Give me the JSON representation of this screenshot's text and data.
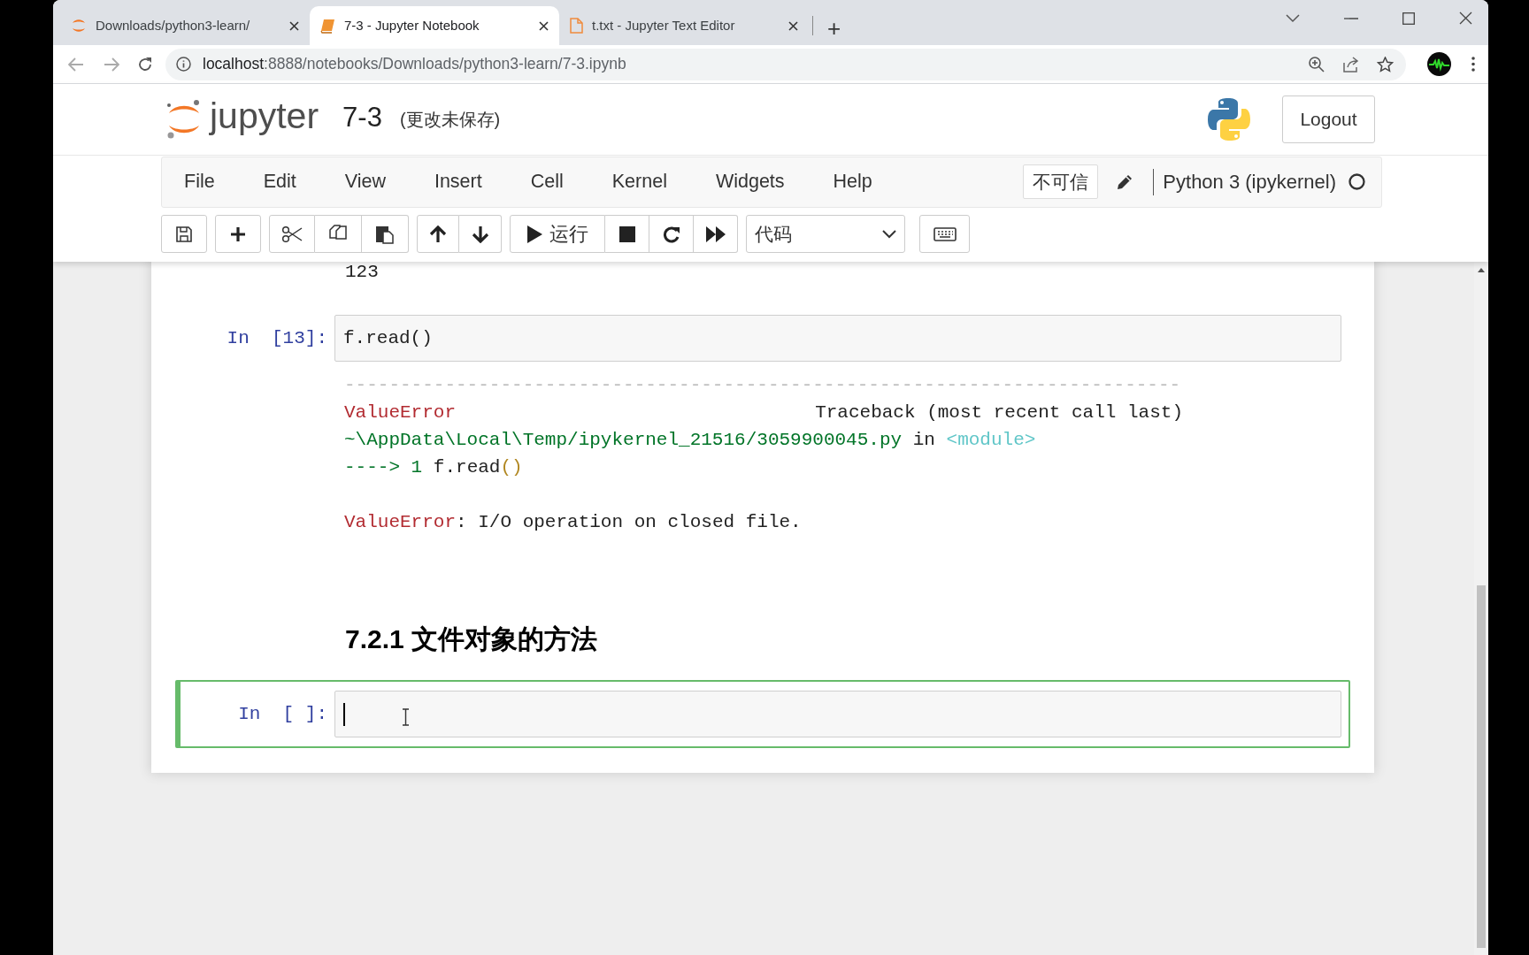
{
  "browser": {
    "tabs": [
      {
        "title": "Downloads/python3-learn/",
        "kind": "jupyter",
        "selected": false
      },
      {
        "title": "7-3 - Jupyter Notebook",
        "kind": "notebook",
        "selected": true
      },
      {
        "title": "t.txt - Jupyter Text Editor",
        "kind": "file",
        "selected": false
      }
    ],
    "new_tab": "+",
    "url_host": "localhost",
    "url_rest": ":8888/notebooks/Downloads/python3-learn/7-3.ipynb"
  },
  "header": {
    "logo_text": "jupyter",
    "notebook_name": "7-3",
    "save_status": "(更改未保存)",
    "logout": "Logout"
  },
  "menu": [
    "File",
    "Edit",
    "View",
    "Insert",
    "Cell",
    "Kernel",
    "Widgets",
    "Help"
  ],
  "trusted": "不可信",
  "kernel": "Python 3 (ipykernel)",
  "toolbar": {
    "run_label": "运行",
    "cell_type": "代码"
  },
  "cells": [
    {
      "kind": "output_tail",
      "text": "123"
    },
    {
      "kind": "code",
      "prompt": "In  [13]:",
      "source": "f.read()",
      "selected": false,
      "output": [
        {
          "segments": [
            {
              "kind": "rule",
              "text": "---------------------------------------------------------------------------"
            }
          ]
        },
        {
          "segments": [
            {
              "kind": "ename",
              "text": "ValueError"
            },
            {
              "kind": "right",
              "text": "Traceback (most recent call last)"
            }
          ]
        },
        {
          "segments": [
            {
              "kind": "path",
              "text": "~\\AppData\\Local\\Temp/ipykernel_21516/3059900045.py"
            },
            {
              "kind": "plain",
              "text": " in "
            },
            {
              "kind": "module",
              "text": "<module>"
            }
          ]
        },
        {
          "segments": [
            {
              "kind": "arrow",
              "text": "----> 1"
            },
            {
              "kind": "plain",
              "text": " f.read"
            },
            {
              "kind": "paren",
              "text": "()"
            }
          ]
        },
        {
          "spaced": true,
          "segments": [
            {
              "kind": "ename",
              "text": "ValueError"
            },
            {
              "kind": "plain",
              "text": ": I/O operation on closed file."
            }
          ]
        }
      ]
    },
    {
      "kind": "markdown",
      "heading": "7.2.1 文件对象的方法"
    },
    {
      "kind": "code",
      "prompt": "In  [ ]:",
      "selected": true
    }
  ]
}
